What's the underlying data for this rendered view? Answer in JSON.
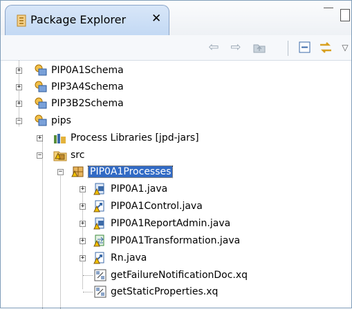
{
  "view": {
    "tab_title": "Package Explorer",
    "close_symbol": "✕"
  },
  "toolbar": {
    "icons": [
      "back-arrow-icon",
      "forward-arrow-icon",
      "up-folder-icon",
      "collapse-all-icon",
      "link-editor-icon",
      "view-menu-icon"
    ]
  },
  "tree": [
    {
      "label": "PIP0A1Schema",
      "expander": "+",
      "icon": "project-icon"
    },
    {
      "label": "PIP3A4Schema",
      "expander": "+",
      "icon": "project-icon"
    },
    {
      "label": "PIP3B2Schema",
      "expander": "+",
      "icon": "project-icon"
    },
    {
      "label": "pips",
      "expander": "−",
      "icon": "project-icon"
    },
    {
      "label": "Process Libraries [jpd-jars]",
      "expander": "+",
      "icon": "library-icon"
    },
    {
      "label": "src",
      "expander": "−",
      "icon": "source-folder-icon"
    },
    {
      "label": "PIP0A1Processes",
      "expander": "−",
      "icon": "package-icon",
      "selected": true
    },
    {
      "label": "PIP0A1.java",
      "expander": "+",
      "icon": "java-process-icon"
    },
    {
      "label": "PIP0A1Control.java",
      "expander": "+",
      "icon": "java-control-icon"
    },
    {
      "label": "PIP0A1ReportAdmin.java",
      "expander": "+",
      "icon": "java-process-icon"
    },
    {
      "label": "PIP0A1Transformation.java",
      "expander": "+",
      "icon": "java-transform-icon"
    },
    {
      "label": "Rn.java",
      "expander": "+",
      "icon": "java-control-icon"
    },
    {
      "label": "getFailureNotificationDoc.xq",
      "expander": "",
      "icon": "xquery-icon"
    },
    {
      "label": "getStaticProperties.xq",
      "expander": "",
      "icon": "xquery-icon"
    }
  ]
}
